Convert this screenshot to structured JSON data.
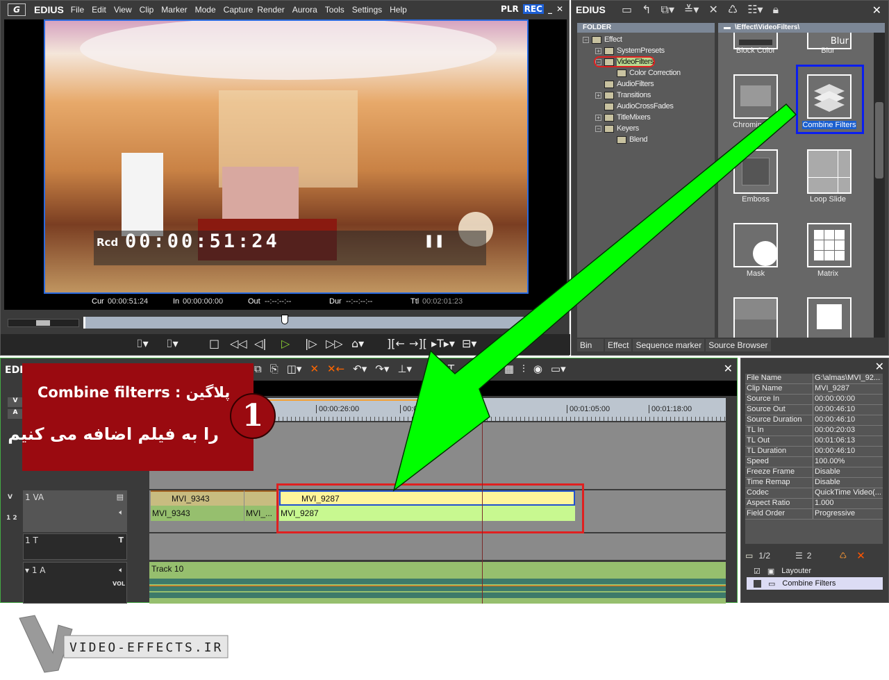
{
  "player": {
    "brand": "EDIUS",
    "menu": [
      "File",
      "Edit",
      "View",
      "Clip",
      "Marker",
      "Mode",
      "Capture",
      "Render",
      "Aurora",
      "Tools",
      "Settings",
      "Help"
    ],
    "plr": "PLR",
    "rec": "REC",
    "timecode_label": "Rcd",
    "timecode": "00:00:51:24",
    "cur_label": "Cur",
    "cur": "00:00:51:24",
    "in_label": "In",
    "in": "00:00:00:00",
    "out_label": "Out",
    "out": "--:--:--:--",
    "dur_label": "Dur",
    "dur": "--:--:--:--",
    "ttl_label": "Ttl",
    "ttl": "00:02:01:23",
    "scrub_position_fraction": 0.43
  },
  "bin": {
    "brand": "EDIUS",
    "folder_header": "FOLDER",
    "path": "\\Effect\\VideoFilters\\",
    "tree": [
      {
        "label": "Effect",
        "level": 0,
        "expander": "−"
      },
      {
        "label": "SystemPresets",
        "level": 1,
        "expander": "+"
      },
      {
        "label": "VideoFilters",
        "level": 1,
        "expander": "−",
        "selected": true
      },
      {
        "label": "Color Correction",
        "level": 2
      },
      {
        "label": "AudioFilters",
        "level": 1
      },
      {
        "label": "Transitions",
        "level": 1,
        "expander": "+"
      },
      {
        "label": "AudioCrossFades",
        "level": 1
      },
      {
        "label": "TitleMixers",
        "level": 1,
        "expander": "+"
      },
      {
        "label": "Keyers",
        "level": 1,
        "expander": "−"
      },
      {
        "label": "Blend",
        "level": 2
      }
    ],
    "effects": [
      "Block Color",
      "Blur",
      "Chrominance",
      "Combine Filters",
      "Emboss",
      "Loop Slide",
      "Mask",
      "Matrix"
    ],
    "blur_thumb_text": "Blur",
    "tabs": [
      "Bin",
      "Effect",
      "Sequence marker",
      "Source Browser"
    ],
    "highlight_color": "#0a1ef0"
  },
  "timeline": {
    "brand": "EDI",
    "ruler": [
      "00:00:26:00",
      "00:00:39:00",
      "00:01:05:00",
      "00:01:18:00"
    ],
    "tracks": {
      "va": "1 VA",
      "t": "1 T",
      "a": "1 A",
      "vol": "VOL",
      "v_btn": "V",
      "a_btn": "A",
      "a12": "1 2"
    },
    "clips_v": [
      "MVI_9343",
      "",
      "MVI_9287"
    ],
    "clips_a": [
      "MVI_9343",
      "MVI_...",
      "MVI_9287"
    ],
    "audio_clip": "Track 10"
  },
  "properties": {
    "rows": [
      [
        "File Name",
        "G:\\almas\\MVI_92..."
      ],
      [
        "Clip Name",
        "MVI_9287"
      ],
      [
        "Source In",
        "00:00:00:00"
      ],
      [
        "Source Out",
        "00:00:46:10"
      ],
      [
        "Source Duration",
        "00:00:46:10"
      ],
      [
        "TL In",
        "00:00:20:03"
      ],
      [
        "TL Out",
        "00:01:06:13"
      ],
      [
        "TL Duration",
        "00:00:46:10"
      ],
      [
        "Speed",
        "100.00%"
      ],
      [
        "Freeze Frame",
        "Disable"
      ],
      [
        "Time Remap",
        "Disable"
      ],
      [
        "Codec",
        "QuickTime Video(..."
      ],
      [
        "Aspect Ratio",
        "1.000"
      ],
      [
        "Field Order",
        "Progressive"
      ]
    ],
    "page": "1/2",
    "count": "2",
    "filters": [
      {
        "label": "Layouter",
        "checked": true
      },
      {
        "label": "Combine Filters",
        "checked": false
      }
    ]
  },
  "overlay": {
    "line1": "Combine filterrs : پلاگین",
    "line2": "را به فیلم اضافه می کنیم",
    "step": "1",
    "arrow_color": "#00ff00",
    "box_color": "#9a0a10"
  },
  "watermark": {
    "text": "Video-Effects.Ir"
  }
}
